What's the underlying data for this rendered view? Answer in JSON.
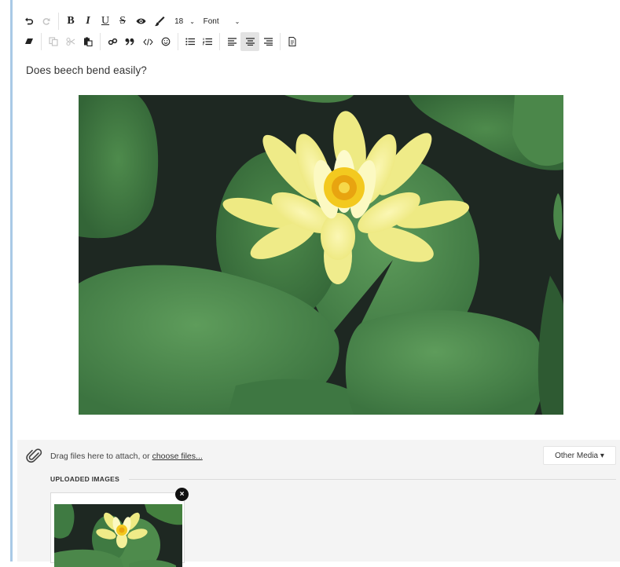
{
  "toolbar": {
    "font_size": "18",
    "font_family": "Font",
    "caret": "⌄"
  },
  "editor": {
    "text": "Does beech bend easily?"
  },
  "attachments": {
    "drag_text": "Drag files here to attach, or ",
    "choose_files": "choose files...",
    "other_media": "Other Media ▾",
    "uploaded_title": "UPLOADED IMAGES",
    "remove_glyph": "×"
  },
  "colors": {
    "accent_rule": "#a9c9e6",
    "panel_bg": "#f4f4f4",
    "active_button": "#e3e3e3"
  },
  "icons": [
    "undo-icon",
    "redo-icon",
    "bold-icon",
    "italic-icon",
    "underline-icon",
    "strikethrough-icon",
    "eye-icon",
    "brush-icon",
    "eraser-icon",
    "copy-icon",
    "cut-icon",
    "paste-icon",
    "link-icon",
    "quote-icon",
    "code-icon",
    "emoji-icon",
    "bullet-list-icon",
    "numbered-list-icon",
    "align-left-icon",
    "align-center-icon",
    "align-right-icon",
    "document-icon",
    "paperclip-icon",
    "close-icon"
  ]
}
